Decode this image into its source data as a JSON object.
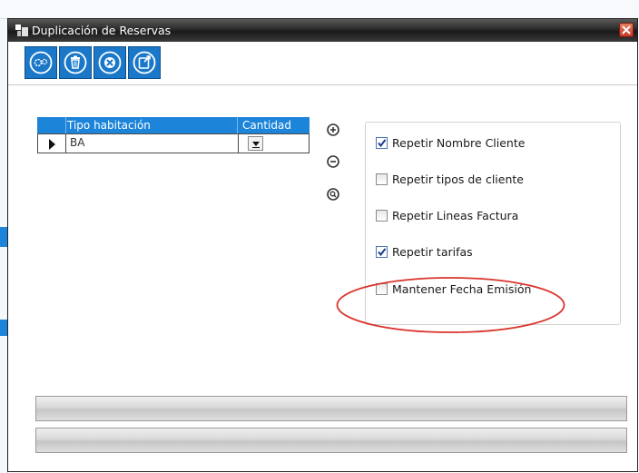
{
  "window": {
    "title": "Duplicación de Reservas"
  },
  "toolbar": {
    "buttons": [
      {
        "icon": "gears-icon"
      },
      {
        "icon": "trash-icon"
      },
      {
        "icon": "cancel-icon"
      },
      {
        "icon": "export-icon"
      }
    ]
  },
  "grid": {
    "columns": [
      "Tipo habitación",
      "Cantidad"
    ],
    "rows": [
      {
        "tipo": "BA",
        "cantidad": ""
      }
    ]
  },
  "side_actions": [
    {
      "icon": "add-circle-icon"
    },
    {
      "icon": "remove-circle-icon"
    },
    {
      "icon": "search-circle-icon"
    }
  ],
  "options": [
    {
      "label": "Repetir Nombre Cliente",
      "checked": true
    },
    {
      "label": "Repetir tipos de cliente",
      "checked": false
    },
    {
      "label": "Repetir Lineas Factura",
      "checked": false
    },
    {
      "label": "Repetir tarifas",
      "checked": true
    },
    {
      "label": "Mantener Fecha Emisión",
      "checked": false
    }
  ],
  "colors": {
    "title_bar": "#2a2a2a",
    "accent": "#1c84d9",
    "toolbar_button": "#1b78c9",
    "highlight_ellipse": "#d9342b"
  }
}
